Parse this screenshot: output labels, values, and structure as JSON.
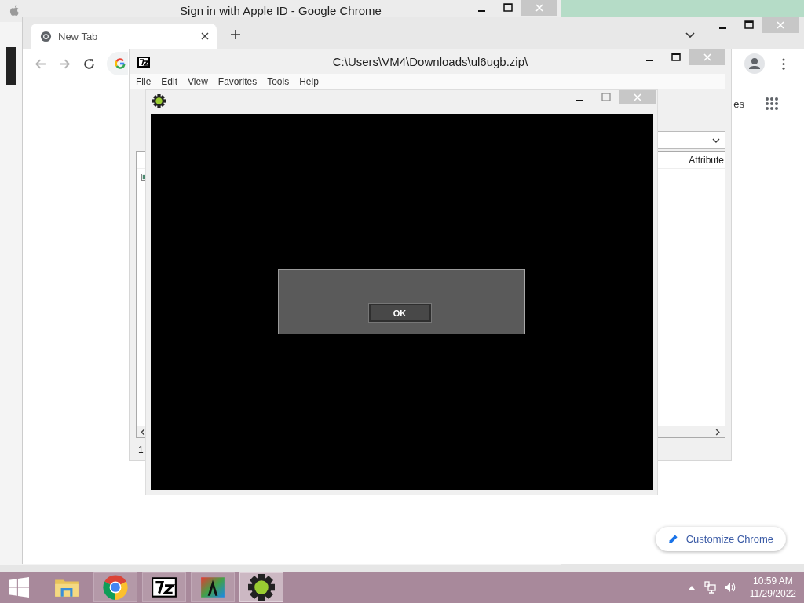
{
  "background_window": {
    "title": "Sign in with Apple ID - Google Chrome"
  },
  "browser": {
    "tabs": [
      {
        "label": "New Tab",
        "selected": true
      }
    ],
    "shortcut_label": "es",
    "customize_button": "Customize Chrome"
  },
  "archive_window": {
    "title": "C:\\Users\\VM4\\Downloads\\ul6ugb.zip\\",
    "menu": [
      "File",
      "Edit",
      "View",
      "Favorites",
      "Tools",
      "Help"
    ],
    "columns": [
      "Attribute"
    ],
    "status": "1"
  },
  "game_window": {
    "dialog": {
      "buttons": [
        "OK"
      ]
    }
  },
  "taskbar": {
    "apps": [
      {
        "kind": "explorer",
        "running": false,
        "selected": false
      },
      {
        "kind": "chrome",
        "running": true,
        "selected": false
      },
      {
        "kind": "archiver",
        "running": true,
        "selected": false
      },
      {
        "kind": "letter-app",
        "running": true,
        "selected": false
      },
      {
        "kind": "gear-app",
        "running": true,
        "selected": true
      }
    ],
    "clock": {
      "time": "10:59 AM",
      "date": "11/29/2022"
    }
  }
}
